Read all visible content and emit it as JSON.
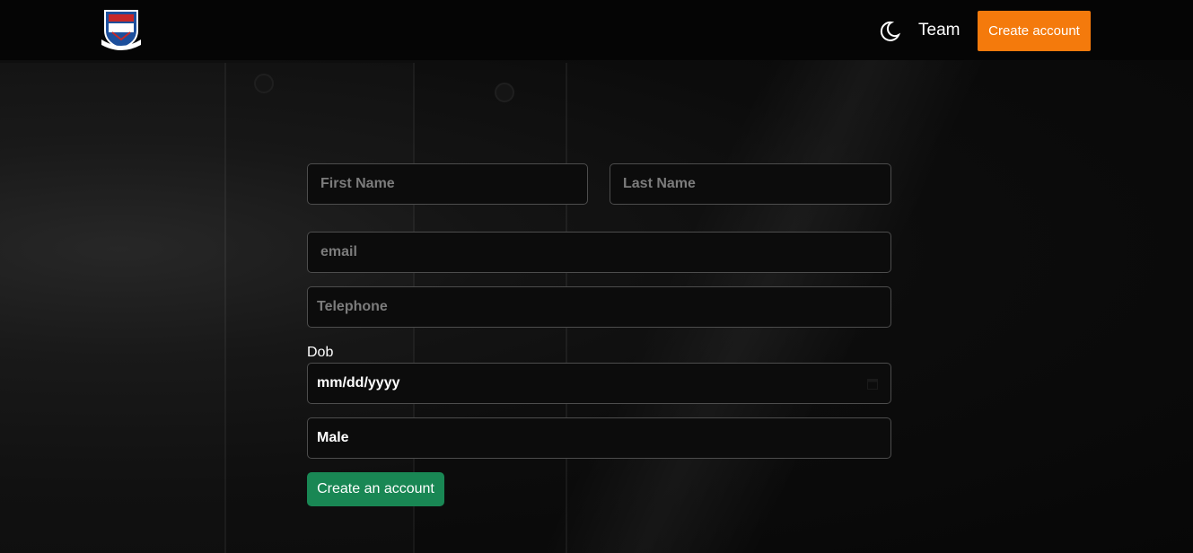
{
  "header": {
    "logo_icon": "school-crest-logo",
    "theme_icon": "moon-icon",
    "team_label": "Team",
    "create_account_label": "Create account"
  },
  "form": {
    "first_name_placeholder": "First Name",
    "last_name_placeholder": "Last Name",
    "email_placeholder": "email",
    "telephone_placeholder": "Telephone",
    "dob_label": "Dob",
    "dob_value": "mm/dd/yyyy",
    "calendar_icon": "calendar-icon",
    "gender_value": "Male",
    "submit_label": "Create an account"
  },
  "colors": {
    "accent_orange": "#f47a0c",
    "submit_green": "#198754",
    "background": "#0b0b0b"
  }
}
